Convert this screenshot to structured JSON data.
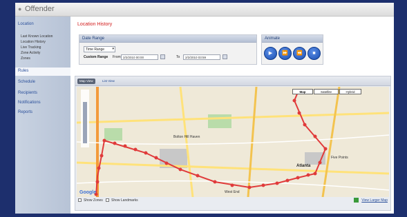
{
  "app": {
    "title": "Offender"
  },
  "sidebar": {
    "section": "Location",
    "sub_items": [
      "Last Known Location",
      "Location History",
      "Live Tracking",
      "Zone Activity",
      "Zones"
    ],
    "items": [
      "Rules",
      "Schedule",
      "Recipients",
      "Notifications",
      "Reports"
    ],
    "active_item": "Rules"
  },
  "main": {
    "page_title": "Location History",
    "date_range": {
      "title": "Date Range",
      "select_value": "Time Range",
      "custom_label": "Custom Range",
      "from_label": "From",
      "from_value": "2/2/2010 00:00",
      "to_label": "To",
      "to_value": "2/2/2010 03:59"
    },
    "animate": {
      "title": "Animate",
      "buttons": [
        "play",
        "fast-forward",
        "rewind",
        "stop"
      ]
    },
    "map_tabs": [
      "Map View",
      "List View"
    ],
    "map_types": [
      "Map",
      "Satellite",
      "Hybrid"
    ],
    "map_labels": {
      "city1": "Bolton Hill Haven",
      "city2": "Atlanta",
      "city3": "Five Points",
      "area": "West End",
      "google": "Google"
    },
    "options": [
      "Show Zones",
      "Show Landmarks"
    ],
    "larger_map": "View Larger Map"
  },
  "colors": {
    "accent": "#1a4fb2",
    "title_red": "#d21a1a",
    "route": "#e03a3a"
  }
}
